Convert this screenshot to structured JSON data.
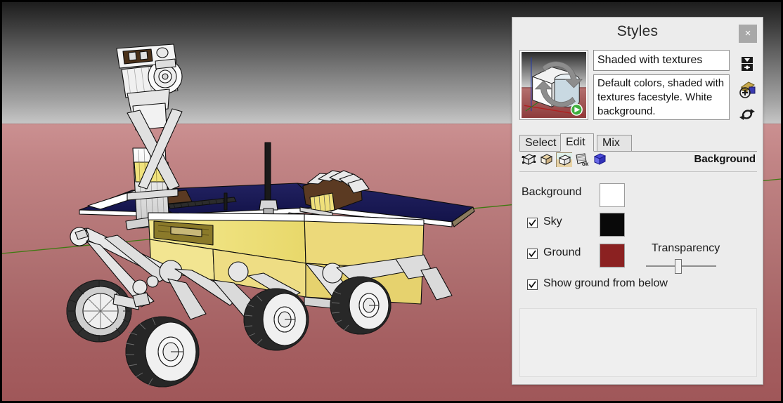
{
  "viewport": {
    "name": "sketchup-3d-viewport",
    "sky_color_top": "#1d1d1d",
    "sky_color_horizon": "#c6c6c6",
    "ground_color_horizon": "#cb9091",
    "ground_color_bottom": "#a05759",
    "axis_line_color": "#3f7a12",
    "model": "mars-rover"
  },
  "panel": {
    "title": "Styles",
    "close_label": "×",
    "style": {
      "name": "Shaded with textures",
      "description": "Default colors, shaded with textures facestyle. White background."
    },
    "side_icons": [
      {
        "name": "style-details-icon",
        "label": "Details"
      },
      {
        "name": "create-new-style-icon",
        "label": "Create new Style"
      },
      {
        "name": "update-style-icon",
        "label": "Update Style with changes to model"
      }
    ],
    "tabs": [
      {
        "label": "Select",
        "name": "tab-select",
        "active": false
      },
      {
        "label": "Edit",
        "name": "tab-edit",
        "active": true
      },
      {
        "label": "Mix",
        "name": "tab-mix",
        "active": false
      }
    ],
    "category_icons": [
      {
        "name": "edge-settings-icon",
        "selected": false
      },
      {
        "name": "face-settings-icon",
        "selected": false
      },
      {
        "name": "background-settings-icon",
        "selected": true
      },
      {
        "name": "watermark-settings-icon",
        "selected": false
      },
      {
        "name": "modeling-settings-icon",
        "selected": false
      }
    ],
    "section_label": "Background",
    "settings": {
      "background": {
        "label": "Background",
        "color": "#ffffff",
        "has_checkbox": false
      },
      "sky": {
        "label": "Sky",
        "color": "#090909",
        "checked": true
      },
      "ground": {
        "label": "Ground",
        "color": "#8b2121",
        "checked": true
      },
      "show_ground_from_below": {
        "label": "Show ground from below",
        "checked": true
      },
      "transparency": {
        "label": "Transparency",
        "value": 45
      }
    }
  }
}
